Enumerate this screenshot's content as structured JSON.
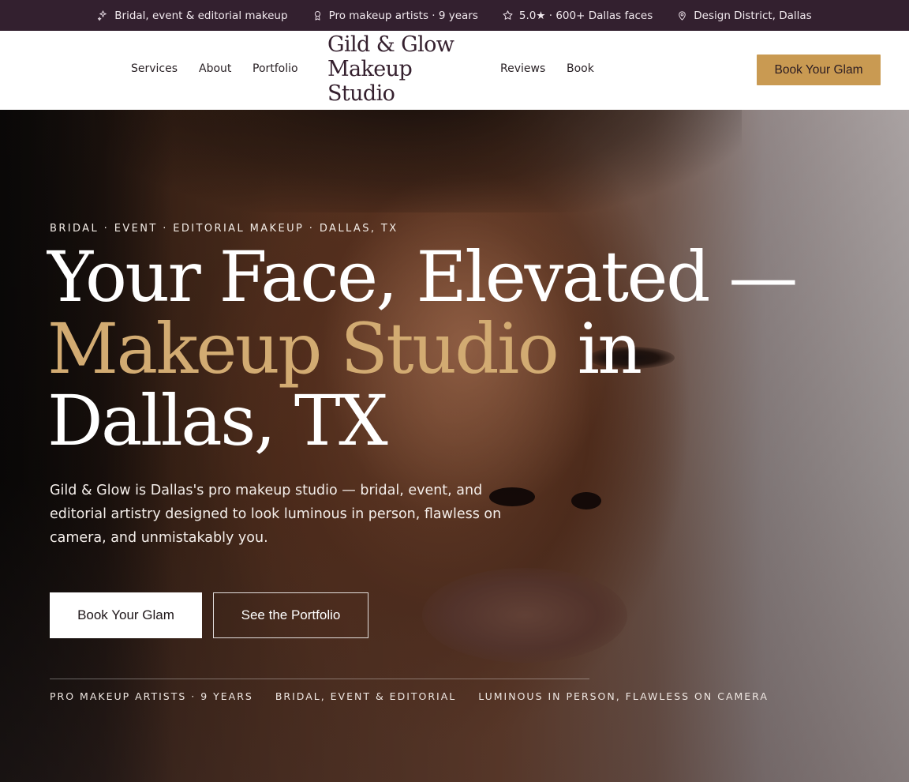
{
  "topbar": {
    "items": [
      {
        "icon": "sparkles-icon",
        "label": "Bridal, event & editorial makeup"
      },
      {
        "icon": "award-icon",
        "label": "Pro makeup artists · 9 years"
      },
      {
        "icon": "star-icon",
        "label": "5.0★ · 600+ Dallas faces"
      },
      {
        "icon": "map-pin-icon",
        "label": "Design District, Dallas"
      }
    ]
  },
  "nav": {
    "left": [
      "Services",
      "About",
      "Portfolio"
    ],
    "right": [
      "Reviews",
      "Book"
    ],
    "logo_lines": [
      "Gild & Glow",
      "Makeup",
      "Studio"
    ],
    "cta": "Book Your Glam"
  },
  "hero": {
    "eyebrow": "BRIDAL · EVENT · EDITORIAL MAKEUP · DALLAS, TX",
    "headline_line1": "Your Face, Elevated —",
    "headline_gold": "Makeup Studio",
    "headline_line2_rest": " in",
    "headline_line3": "Dallas, TX",
    "lede": "Gild & Glow is Dallas's pro makeup studio — bridal, event, and editorial artistry designed to look luminous in person, flawless on camera, and unmistakably you.",
    "primary_cta": "Book Your Glam",
    "secondary_cta": "See the Portfolio",
    "stats": [
      "PRO MAKEUP ARTISTS · 9 YEARS",
      "BRIDAL, EVENT & EDITORIAL",
      "LUMINOUS IN PERSON, FLAWLESS ON CAMERA"
    ]
  },
  "colors": {
    "topbar_bg": "#33202f",
    "accent_gold": "#c99a52",
    "headline_gold": "#d2ab72",
    "logo": "#35202e"
  }
}
